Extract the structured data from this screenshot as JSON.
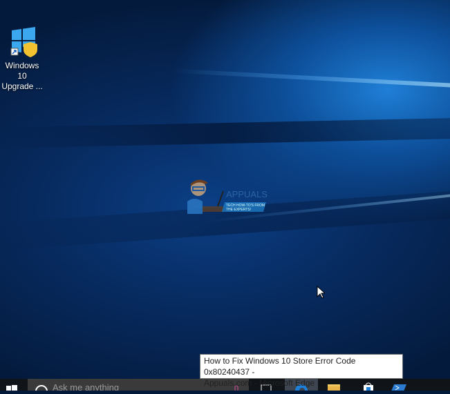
{
  "desktop": {
    "icons": [
      {
        "label_line1": "Windows 10",
        "label_line2": "Upgrade ..."
      }
    ],
    "watermark": {
      "brand": "APPUALS",
      "tagline": "TECH HOW-TO'S FROM THE EXPERTS!"
    }
  },
  "tooltip": {
    "line1": "How to Fix Windows 10 Store Error Code 0x80240437 -",
    "line2": "Appuals.com - Microsoft Edge"
  },
  "taskbar": {
    "search_placeholder": "Ask me anything",
    "apps": [
      "task-view",
      "microsoft-edge",
      "file-explorer",
      "store",
      "powershell"
    ],
    "active_color": "#3c4550"
  }
}
